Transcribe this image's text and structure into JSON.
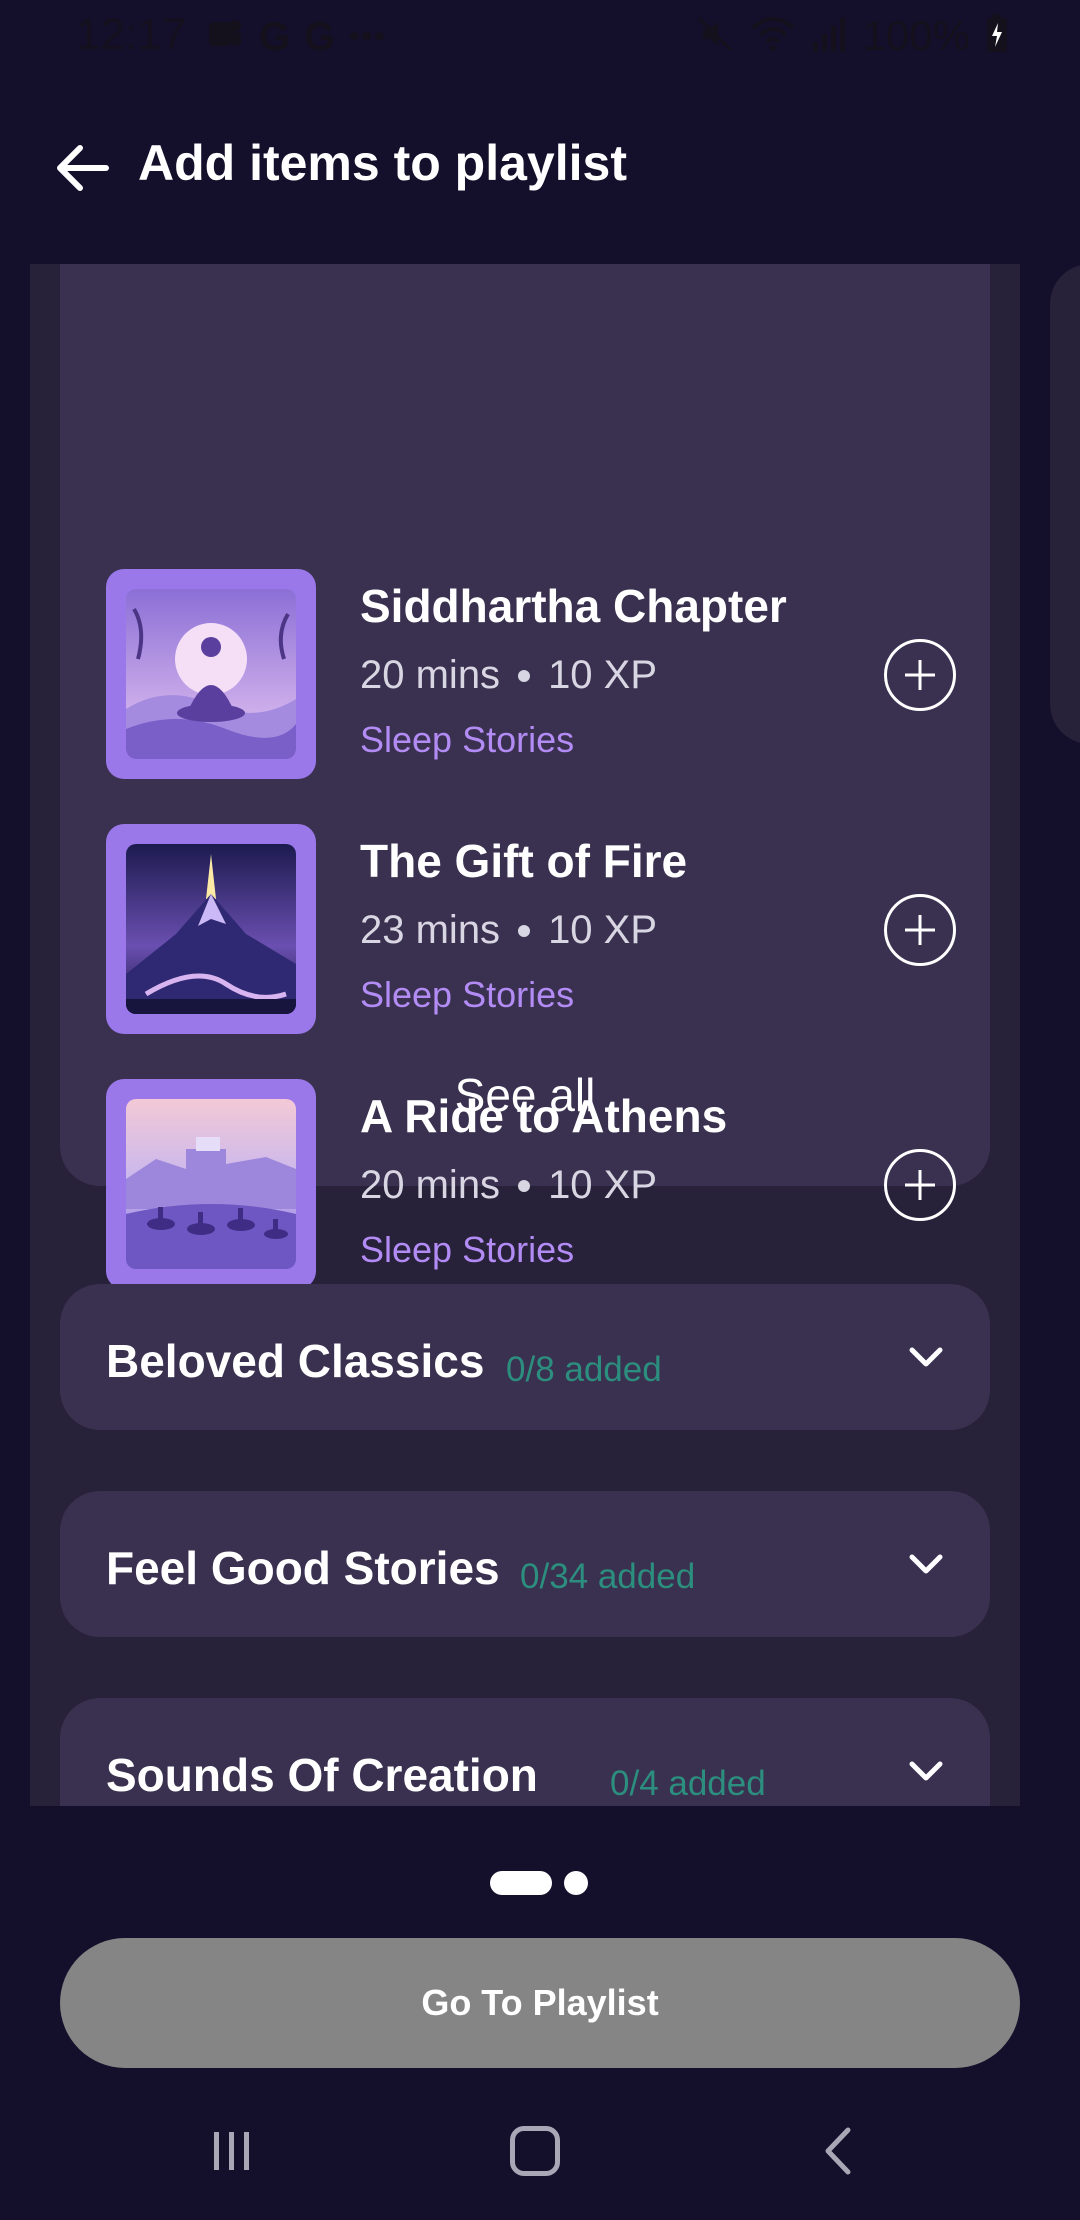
{
  "status_bar": {
    "time": "12:17",
    "left_icons": [
      "teams-icon",
      "google-icon",
      "google-icon",
      "more-icon"
    ],
    "glyph_g": "G",
    "more": "•••",
    "battery": "100%"
  },
  "header": {
    "title": "Add items to playlist"
  },
  "stories": [
    {
      "title": "Siddhartha Chapter",
      "duration": "20 mins",
      "xp": "10 XP",
      "category": "Sleep Stories"
    },
    {
      "title": "The Gift of Fire",
      "duration": "23 mins",
      "xp": "10 XP",
      "category": "Sleep Stories"
    },
    {
      "title": "A Ride to Athens",
      "duration": "20 mins",
      "xp": "10 XP",
      "category": "Sleep Stories"
    }
  ],
  "see_all_label": "See all",
  "categories": [
    {
      "title": "Beloved Classics",
      "count": "0/8 added"
    },
    {
      "title": "Feel Good Stories",
      "count": "0/34 added"
    },
    {
      "title": "Sounds Of Creation",
      "count": "0/4 added"
    }
  ],
  "pager": {
    "pages": 2,
    "current": 1
  },
  "cta_label": "Go To Playlist",
  "colors": {
    "background": "#140f2b",
    "card": "#3a3150",
    "accent_purple": "#9a78ea",
    "category_text": "#b28cf4",
    "count_text": "#2c8e7e",
    "cta": "#858585"
  }
}
